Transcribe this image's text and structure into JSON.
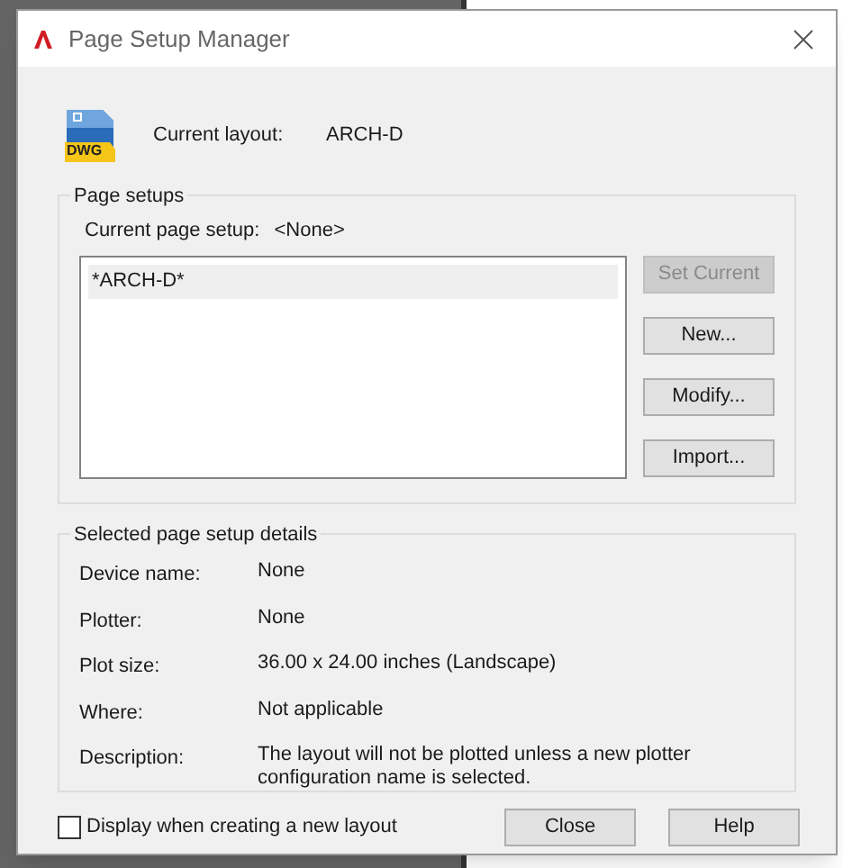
{
  "window": {
    "title": "Page Setup Manager"
  },
  "file_icon_label": "DWG",
  "current_layout": {
    "label": "Current layout:",
    "value": "ARCH-D"
  },
  "page_setups": {
    "title": "Page setups",
    "current_label": "Current page setup:",
    "current_value": "<None>",
    "items": [
      {
        "label": "*ARCH-D*",
        "selected": true
      }
    ],
    "buttons": [
      {
        "label": "Set Current",
        "disabled": true
      },
      {
        "label": "New...",
        "disabled": false
      },
      {
        "label": "Modify...",
        "disabled": false
      },
      {
        "label": "Import...",
        "disabled": false
      }
    ]
  },
  "details": {
    "title": "Selected page setup details",
    "rows": [
      {
        "label": "Device name:",
        "value": "None"
      },
      {
        "label": "Plotter:",
        "value": "None"
      },
      {
        "label": "Plot size:",
        "value": "36.00 x 24.00 inches (Landscape)"
      },
      {
        "label": "Where:",
        "value": "Not applicable"
      },
      {
        "label": "Description:",
        "value": "The layout will not be plotted unless a new plotter configuration name is selected."
      }
    ]
  },
  "display_checkbox": {
    "label": "Display when creating a new layout",
    "checked": false
  },
  "buttons": [
    "Close",
    "Help"
  ]
}
